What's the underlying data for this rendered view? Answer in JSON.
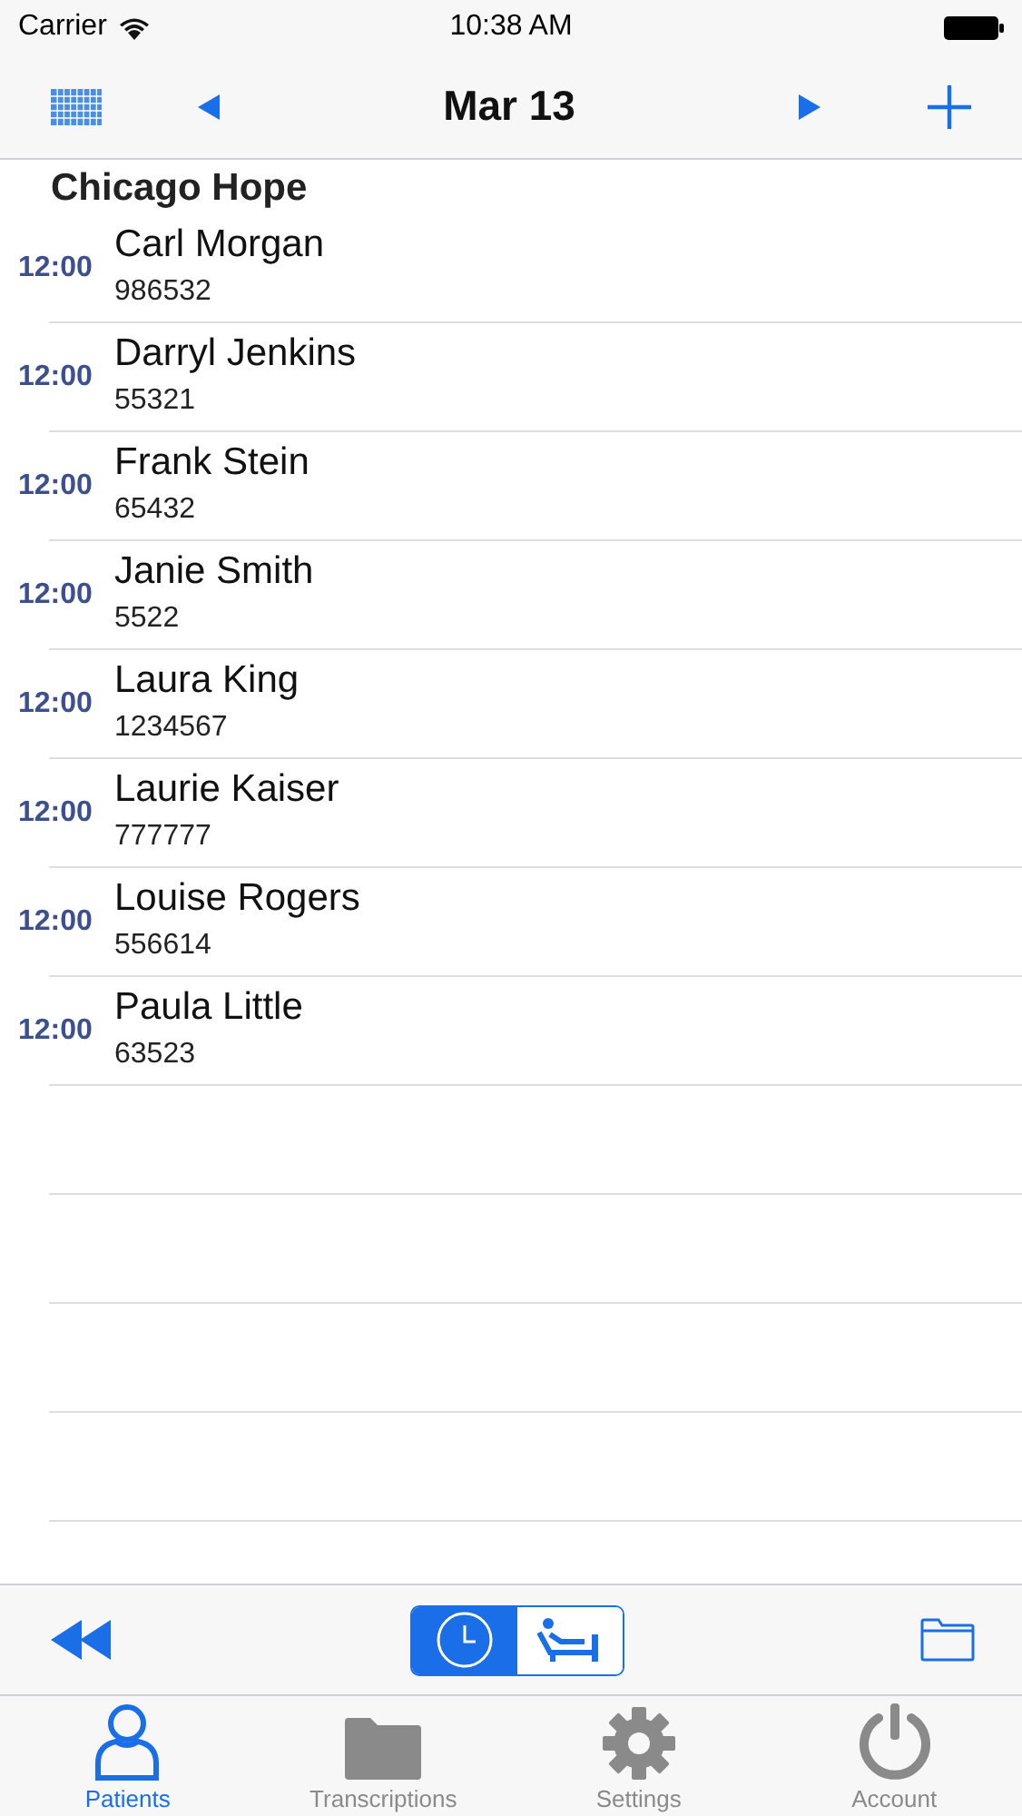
{
  "status_bar": {
    "carrier": "Carrier",
    "time": "10:38 AM"
  },
  "nav": {
    "title": "Mar 13"
  },
  "group": {
    "title": "Chicago Hope"
  },
  "patients": [
    {
      "time": "12:00",
      "name": "Carl Morgan",
      "id": "986532"
    },
    {
      "time": "12:00",
      "name": "Darryl Jenkins",
      "id": "55321"
    },
    {
      "time": "12:00",
      "name": "Frank Stein",
      "id": "65432"
    },
    {
      "time": "12:00",
      "name": "Janie Smith",
      "id": "5522"
    },
    {
      "time": "12:00",
      "name": "Laura King",
      "id": "1234567"
    },
    {
      "time": "12:00",
      "name": "Laurie Kaiser",
      "id": "777777"
    },
    {
      "time": "12:00",
      "name": "Louise Rogers",
      "id": "556614"
    },
    {
      "time": "12:00",
      "name": "Paula Little",
      "id": "63523"
    }
  ],
  "view_toggle": [
    {
      "kind": "clock",
      "selected": true
    },
    {
      "kind": "bed",
      "selected": false
    }
  ],
  "tabs": [
    {
      "kind": "person",
      "label": "Patients",
      "selected": true
    },
    {
      "kind": "folder",
      "label": "Transcriptions",
      "selected": false
    },
    {
      "kind": "gear",
      "label": "Settings",
      "selected": false
    },
    {
      "kind": "power",
      "label": "Account",
      "selected": false
    }
  ]
}
